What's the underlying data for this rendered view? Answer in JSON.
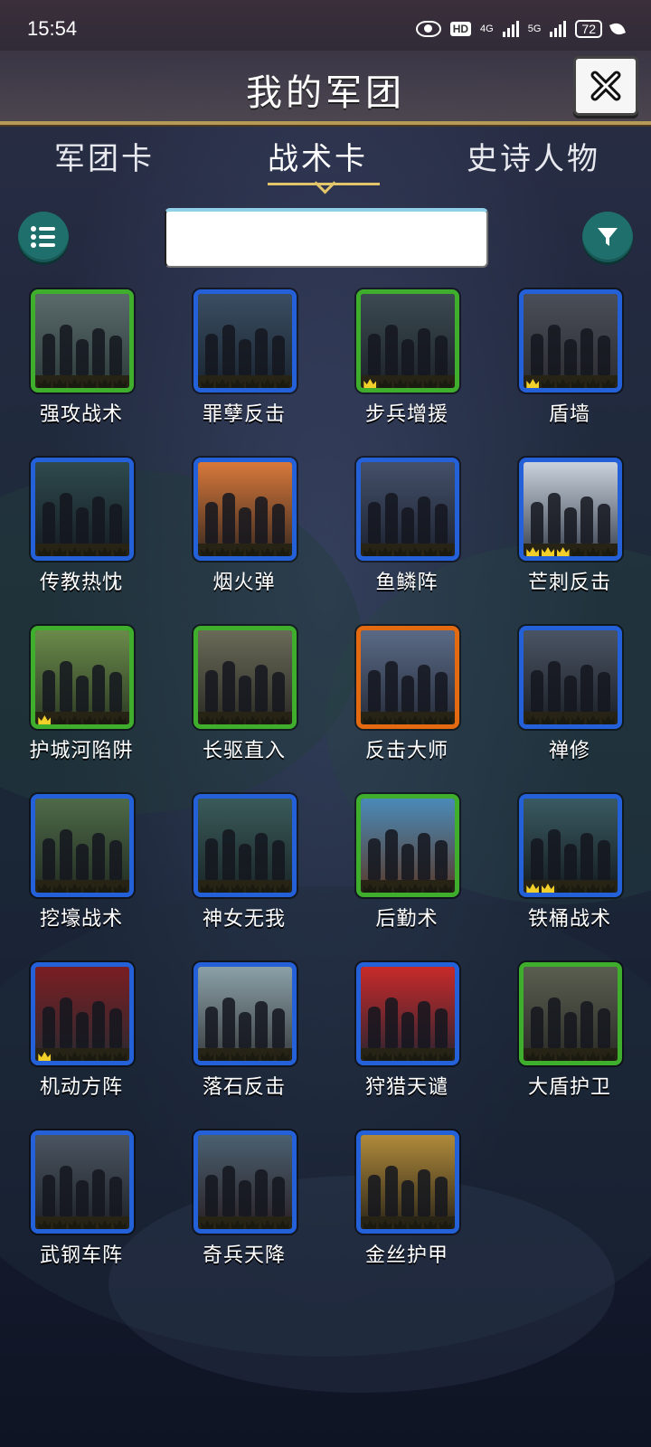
{
  "status_bar": {
    "time": "15:54",
    "hd": "HD",
    "net1": "4G",
    "net2": "5G",
    "battery": "72"
  },
  "header": {
    "title": "我的军团",
    "close_icon": "close-icon"
  },
  "tabs": [
    {
      "label": "军团卡",
      "active": false
    },
    {
      "label": "战术卡",
      "active": true
    },
    {
      "label": "史诗人物",
      "active": false
    }
  ],
  "toolbar": {
    "list_icon": "list-icon",
    "filter_icon": "filter-icon",
    "search_value": ""
  },
  "colors": {
    "rarity_blue": "#2460d8",
    "rarity_green": "#3fae2c",
    "rarity_orange": "#e46a12",
    "crown_gold": "#f3cf2a",
    "accent_gold": "#e2c56a"
  },
  "cards": [
    {
      "name": "强攻战术",
      "rarity": "green",
      "stars": 0,
      "art": "knights-charge"
    },
    {
      "name": "罪孽反击",
      "rarity": "blue",
      "stars": 0,
      "art": "dark-soldiers"
    },
    {
      "name": "步兵增援",
      "rarity": "green",
      "stars": 1,
      "art": "armored-infantry"
    },
    {
      "name": "盾墙",
      "rarity": "blue",
      "stars": 1,
      "art": "shield-cross"
    },
    {
      "name": "传教热忱",
      "rarity": "blue",
      "stars": 0,
      "art": "preacher"
    },
    {
      "name": "烟火弹",
      "rarity": "blue",
      "stars": 0,
      "art": "explosion"
    },
    {
      "name": "鱼鳞阵",
      "rarity": "blue",
      "stars": 0,
      "art": "formation"
    },
    {
      "name": "芒刺反击",
      "rarity": "blue",
      "stars": 3,
      "art": "reaper"
    },
    {
      "name": "护城河陷阱",
      "rarity": "green",
      "stars": 1,
      "art": "moat-ruins"
    },
    {
      "name": "长驱直入",
      "rarity": "green",
      "stars": 0,
      "art": "cavalry"
    },
    {
      "name": "反击大师",
      "rarity": "orange",
      "stars": 0,
      "art": "shield-knight"
    },
    {
      "name": "禅修",
      "rarity": "blue",
      "stars": 0,
      "art": "monk"
    },
    {
      "name": "挖壕战术",
      "rarity": "blue",
      "stars": 0,
      "art": "hill-castle"
    },
    {
      "name": "神女无我",
      "rarity": "blue",
      "stars": 0,
      "art": "goddess-statue"
    },
    {
      "name": "后勤术",
      "rarity": "green",
      "stars": 0,
      "art": "village"
    },
    {
      "name": "铁桶战术",
      "rarity": "blue",
      "stars": 2,
      "art": "helmets"
    },
    {
      "name": "机动方阵",
      "rarity": "blue",
      "stars": 1,
      "art": "phalanx"
    },
    {
      "name": "落石反击",
      "rarity": "blue",
      "stars": 0,
      "art": "rockfall"
    },
    {
      "name": "狩猎天谴",
      "rarity": "blue",
      "stars": 0,
      "art": "red-hunt"
    },
    {
      "name": "大盾护卫",
      "rarity": "green",
      "stars": 0,
      "art": "big-shield"
    },
    {
      "name": "武钢车阵",
      "rarity": "blue",
      "stars": 0,
      "art": "war-carts"
    },
    {
      "name": "奇兵天降",
      "rarity": "blue",
      "stars": 0,
      "art": "warrior-woman"
    },
    {
      "name": "金丝护甲",
      "rarity": "blue",
      "stars": 0,
      "art": "golden-armor"
    }
  ]
}
